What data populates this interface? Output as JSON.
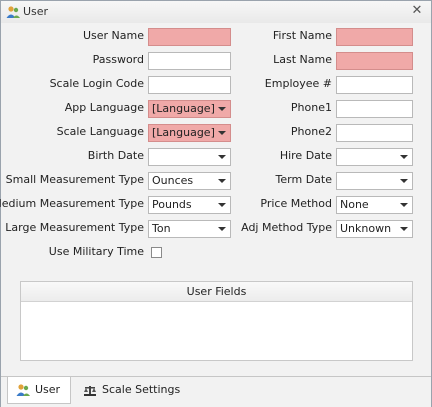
{
  "window": {
    "title": "User",
    "close_glyph": "✕",
    "icon": "users-icon"
  },
  "fields": {
    "user_name": {
      "label": "User Name",
      "value": "",
      "required": true
    },
    "password": {
      "label": "Password",
      "value": ""
    },
    "scale_login_code": {
      "label": "Scale Login Code",
      "value": ""
    },
    "app_language": {
      "label": "App Language",
      "value": "[Language]",
      "required": true
    },
    "scale_language": {
      "label": "Scale Language",
      "value": "[Language]",
      "required": true
    },
    "birth_date": {
      "label": "Birth Date",
      "value": ""
    },
    "small_measurement_type": {
      "label": "Small Measurement Type",
      "value": "Ounces"
    },
    "medium_measurement_type": {
      "label": "Medium Measurement Type",
      "value": "Pounds"
    },
    "large_measurement_type": {
      "label": "Large Measurement Type",
      "value": "Ton"
    },
    "use_military_time": {
      "label": "Use Military Time",
      "checked": false
    },
    "first_name": {
      "label": "First Name",
      "value": "",
      "required": true
    },
    "last_name": {
      "label": "Last Name",
      "value": "",
      "required": true
    },
    "employee_number": {
      "label": "Employee #",
      "value": ""
    },
    "phone1": {
      "label": "Phone1",
      "value": ""
    },
    "phone2": {
      "label": "Phone2",
      "value": ""
    },
    "hire_date": {
      "label": "Hire Date",
      "value": ""
    },
    "term_date": {
      "label": "Term Date",
      "value": ""
    },
    "price_method": {
      "label": "Price Method",
      "value": "None"
    },
    "adj_method_type": {
      "label": "Adj Method Type",
      "value": "Unknown"
    }
  },
  "user_fields_group": {
    "title": "User Fields"
  },
  "tabs": [
    {
      "label": "User",
      "icon": "users-icon",
      "active": true
    },
    {
      "label": "Scale Settings",
      "icon": "scale-icon",
      "active": false
    }
  ],
  "colors": {
    "required": "#f0a9a8",
    "border": "#b9b9b9",
    "background": "#f2f2f2"
  }
}
